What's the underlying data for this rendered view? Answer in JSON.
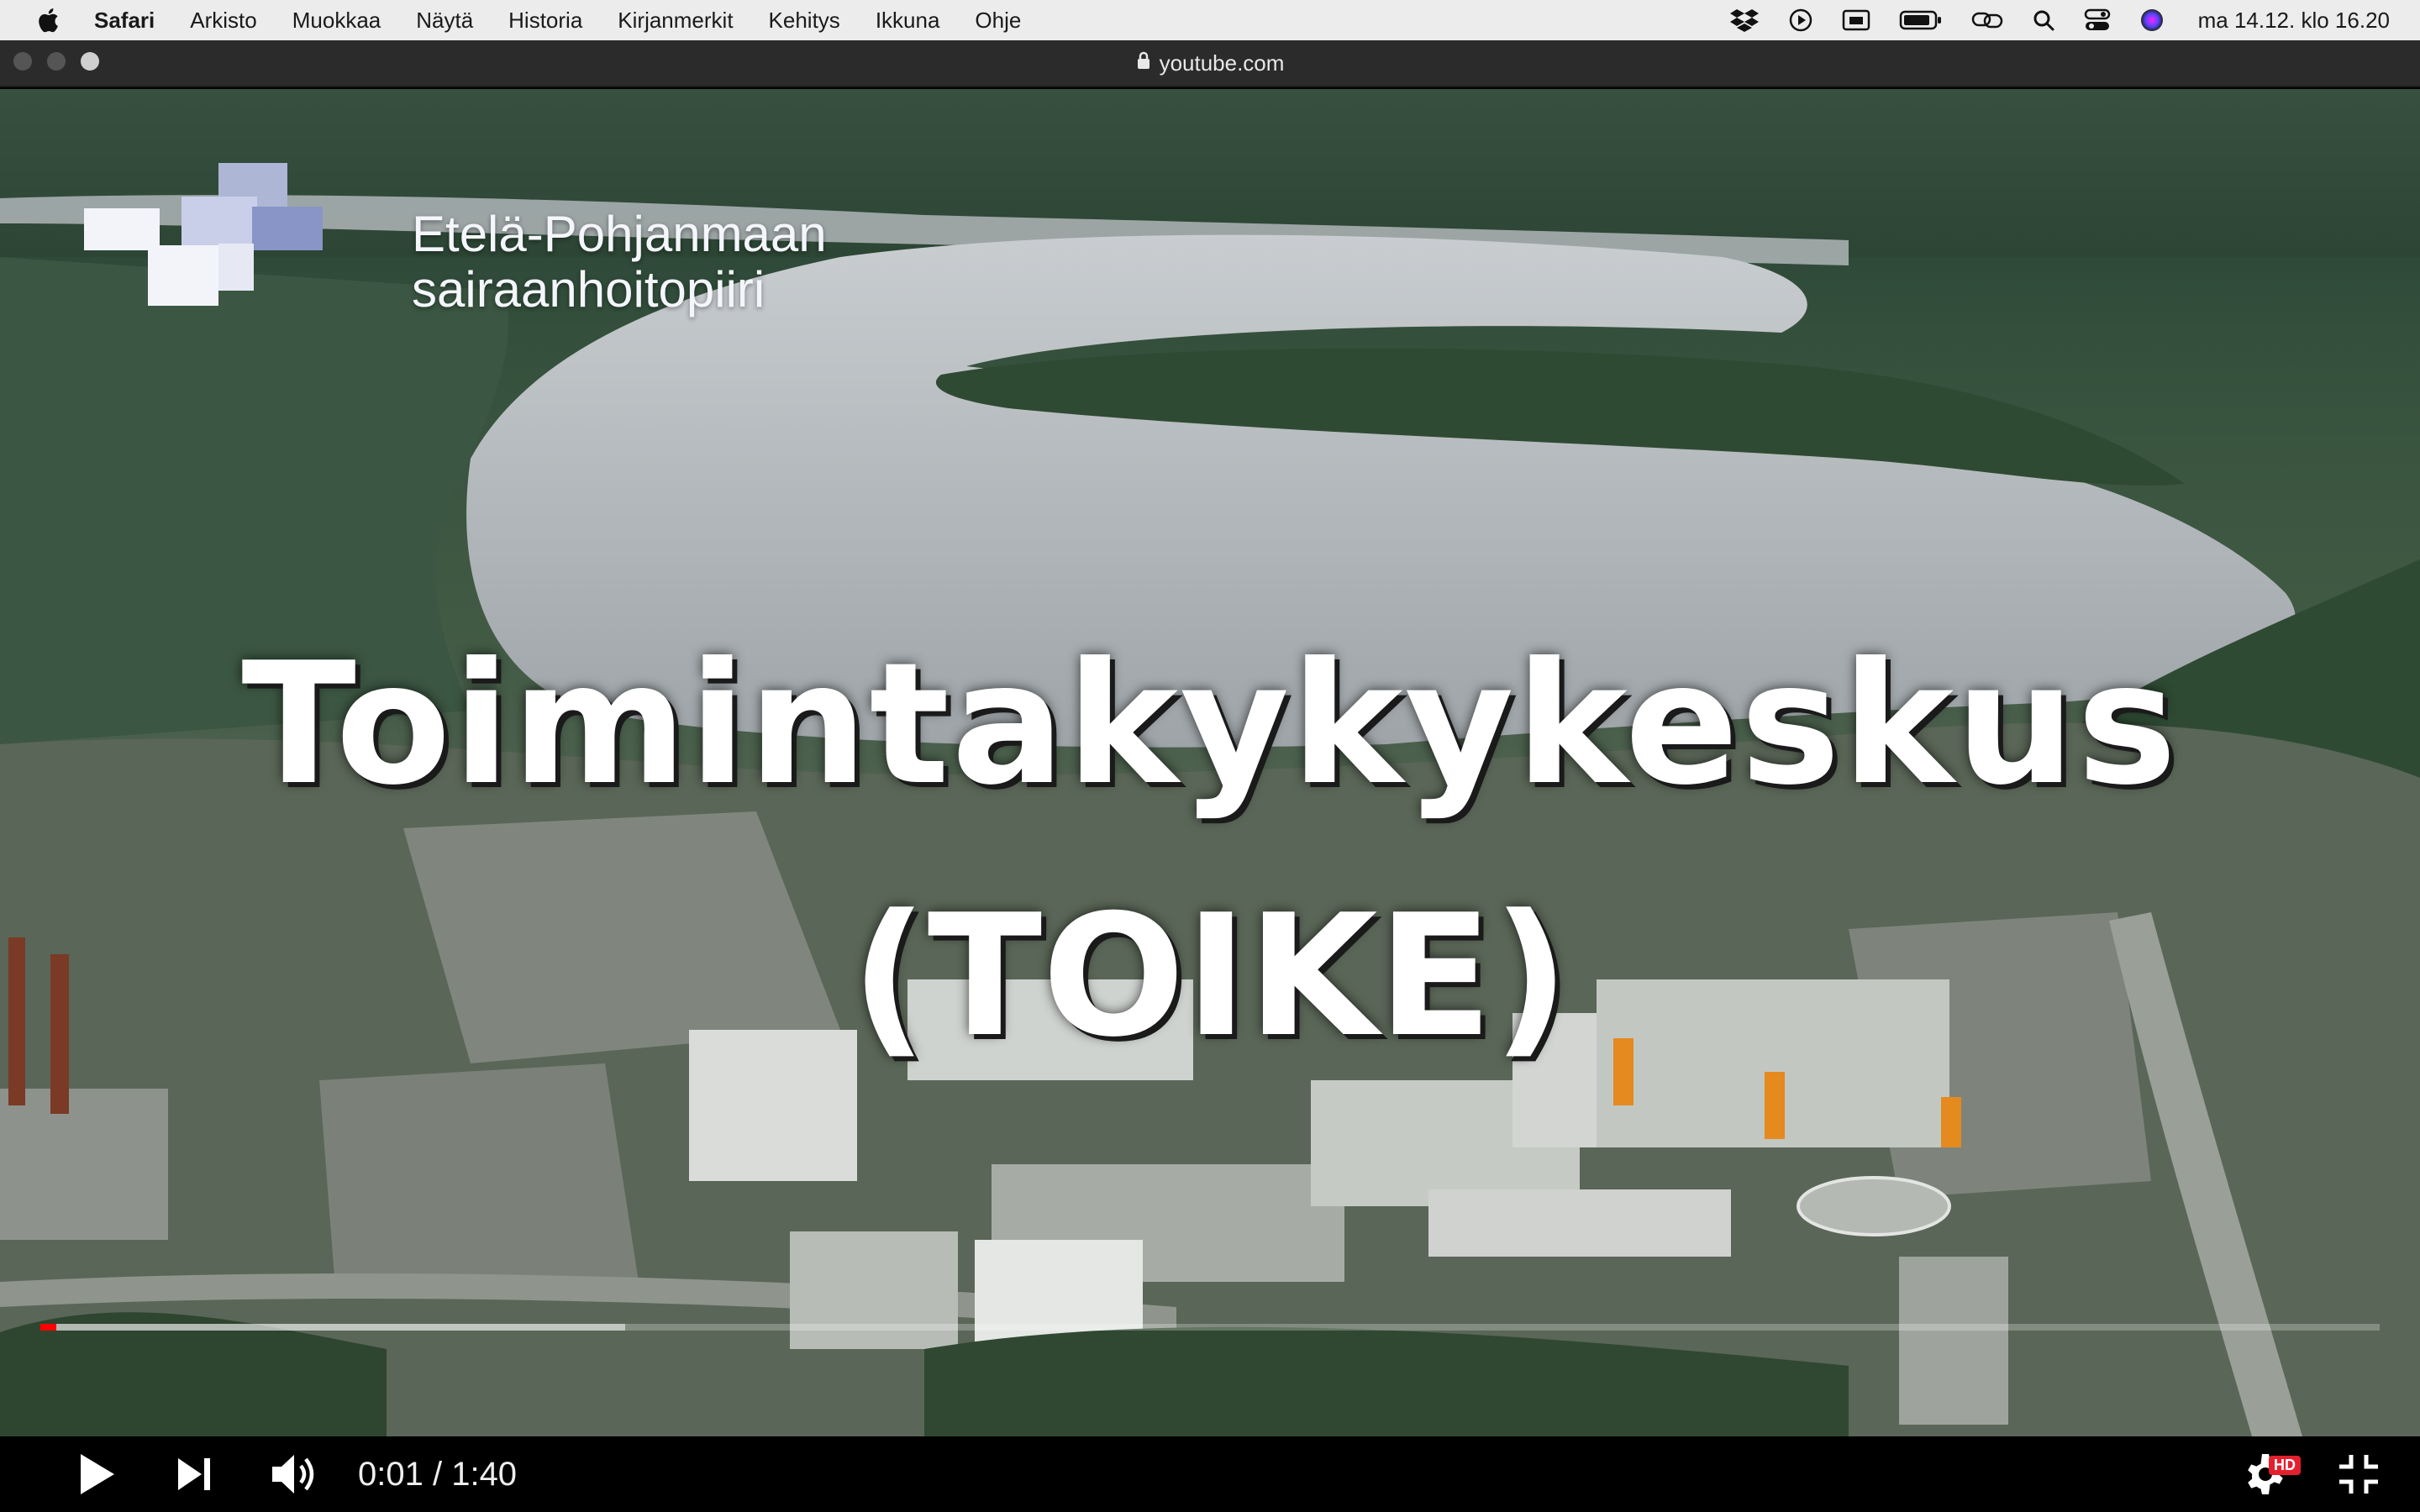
{
  "menubar": {
    "app_name": "Safari",
    "items": [
      "Arkisto",
      "Muokkaa",
      "Näytä",
      "Historia",
      "Kirjanmerkit",
      "Kehitys",
      "Ikkuna",
      "Ohje"
    ],
    "clock": "ma 14.12. klo 16.20",
    "status_icons": [
      "dropbox-icon",
      "play-circle-icon",
      "screen-icon",
      "battery-icon",
      "link-icon",
      "search-icon",
      "control-center-icon",
      "siri-icon"
    ]
  },
  "browser": {
    "url": "youtube.com"
  },
  "video": {
    "logo_line1": "Etelä-Pohjanmaan",
    "logo_line2": "sairaanhoitopiiri",
    "title_line1": "Toimintakykykeskus",
    "title_line2": "(TOIKE)",
    "played_fraction": 0.007,
    "loaded_fraction": 0.25
  },
  "controls": {
    "current_time": "0:01",
    "separator": " / ",
    "duration": "1:40",
    "hd_label": "HD"
  },
  "colors": {
    "progress_played": "#ff0000",
    "hd_badge": "#e5202e"
  }
}
